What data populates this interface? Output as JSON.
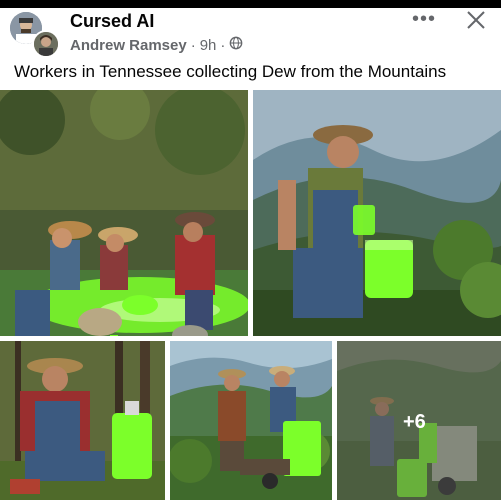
{
  "post": {
    "group_name": "Cursed AI",
    "author": "Andrew Ramsey",
    "time": "9h",
    "separator": "·",
    "privacy_icon": "globe-icon",
    "caption": "Workers in Tennessee collecting Dew from the Mountains",
    "more_icon": "more-horizontal-icon",
    "close_icon": "close-icon",
    "more_photos_count": "+6"
  },
  "photos": [
    {
      "name": "photo-workers-pouring-dew-stream"
    },
    {
      "name": "photo-worker-filling-jug-mountain"
    },
    {
      "name": "photo-worker-jug-forest"
    },
    {
      "name": "photo-two-workers-wheelbarrow"
    },
    {
      "name": "photo-workers-dew-machine"
    }
  ],
  "colors": {
    "dew_green": "#7CFF2A",
    "meta_grey": "#65676b",
    "text": "#050505"
  }
}
